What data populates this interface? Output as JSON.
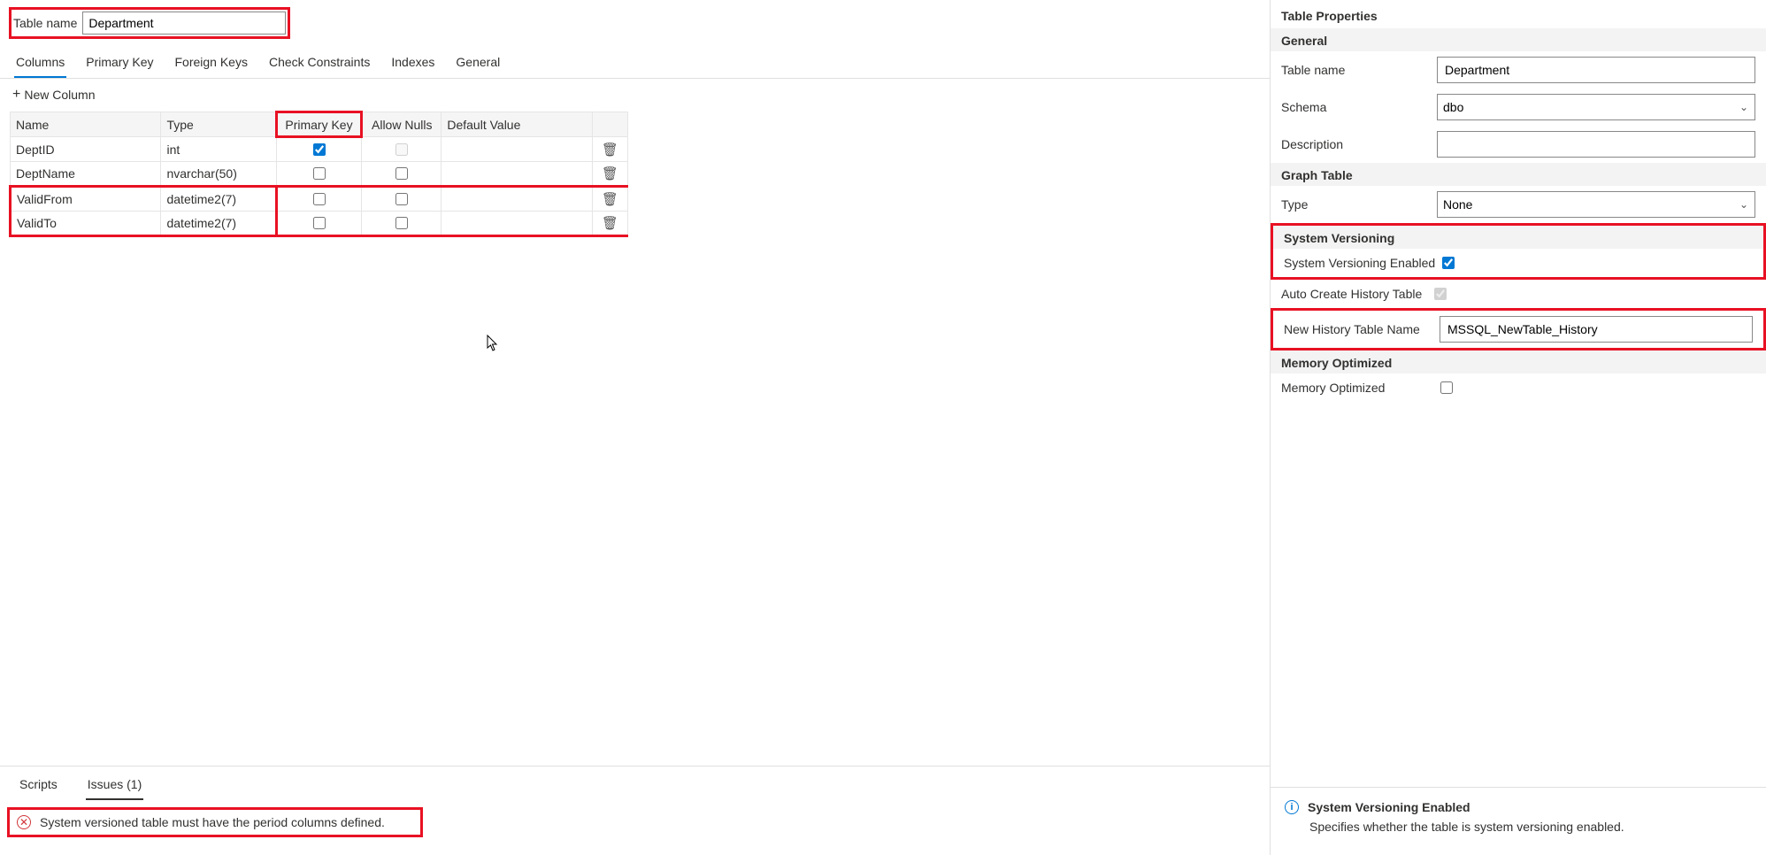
{
  "top": {
    "table_name_label": "Table name",
    "table_name_value": "Department"
  },
  "tabs": {
    "columns": "Columns",
    "primary_key": "Primary Key",
    "foreign_keys": "Foreign Keys",
    "check_constraints": "Check Constraints",
    "indexes": "Indexes",
    "general": "General",
    "active": "Columns"
  },
  "new_column_label": "New Column",
  "grid": {
    "headers": {
      "name": "Name",
      "type": "Type",
      "pk": "Primary Key",
      "allow_nulls": "Allow Nulls",
      "default": "Default Value"
    },
    "rows": [
      {
        "name": "DeptID",
        "type": "int",
        "pk": true,
        "pk_disabled": false,
        "allow_nulls": false,
        "allow_nulls_disabled": true,
        "default": ""
      },
      {
        "name": "DeptName",
        "type": "nvarchar(50)",
        "pk": false,
        "pk_disabled": false,
        "allow_nulls": false,
        "allow_nulls_disabled": false,
        "default": ""
      },
      {
        "name": "ValidFrom",
        "type": "datetime2(7)",
        "pk": false,
        "pk_disabled": false,
        "allow_nulls": false,
        "allow_nulls_disabled": false,
        "default": ""
      },
      {
        "name": "ValidTo",
        "type": "datetime2(7)",
        "pk": false,
        "pk_disabled": false,
        "allow_nulls": false,
        "allow_nulls_disabled": false,
        "default": ""
      }
    ]
  },
  "bottom_tabs": {
    "scripts": "Scripts",
    "issues": "Issues (1)",
    "active": "Issues (1)"
  },
  "issue": {
    "text": "System versioned table must have the period columns defined."
  },
  "side": {
    "title": "Table Properties",
    "general": {
      "heading": "General",
      "table_name_label": "Table name",
      "table_name_value": "Department",
      "schema_label": "Schema",
      "schema_value": "dbo",
      "description_label": "Description",
      "description_value": ""
    },
    "graph": {
      "heading": "Graph Table",
      "type_label": "Type",
      "type_value": "None"
    },
    "sysver": {
      "heading": "System Versioning",
      "enabled_label": "System Versioning Enabled",
      "enabled": true,
      "auto_label": "Auto Create History Table",
      "auto": true,
      "auto_disabled": true,
      "hist_label": "New History Table Name",
      "hist_value": "MSSQL_NewTable_History"
    },
    "mem": {
      "heading": "Memory Optimized",
      "label": "Memory Optimized",
      "value": false
    },
    "hint": {
      "title": "System Versioning Enabled",
      "body": "Specifies whether the table is system versioning enabled."
    }
  }
}
